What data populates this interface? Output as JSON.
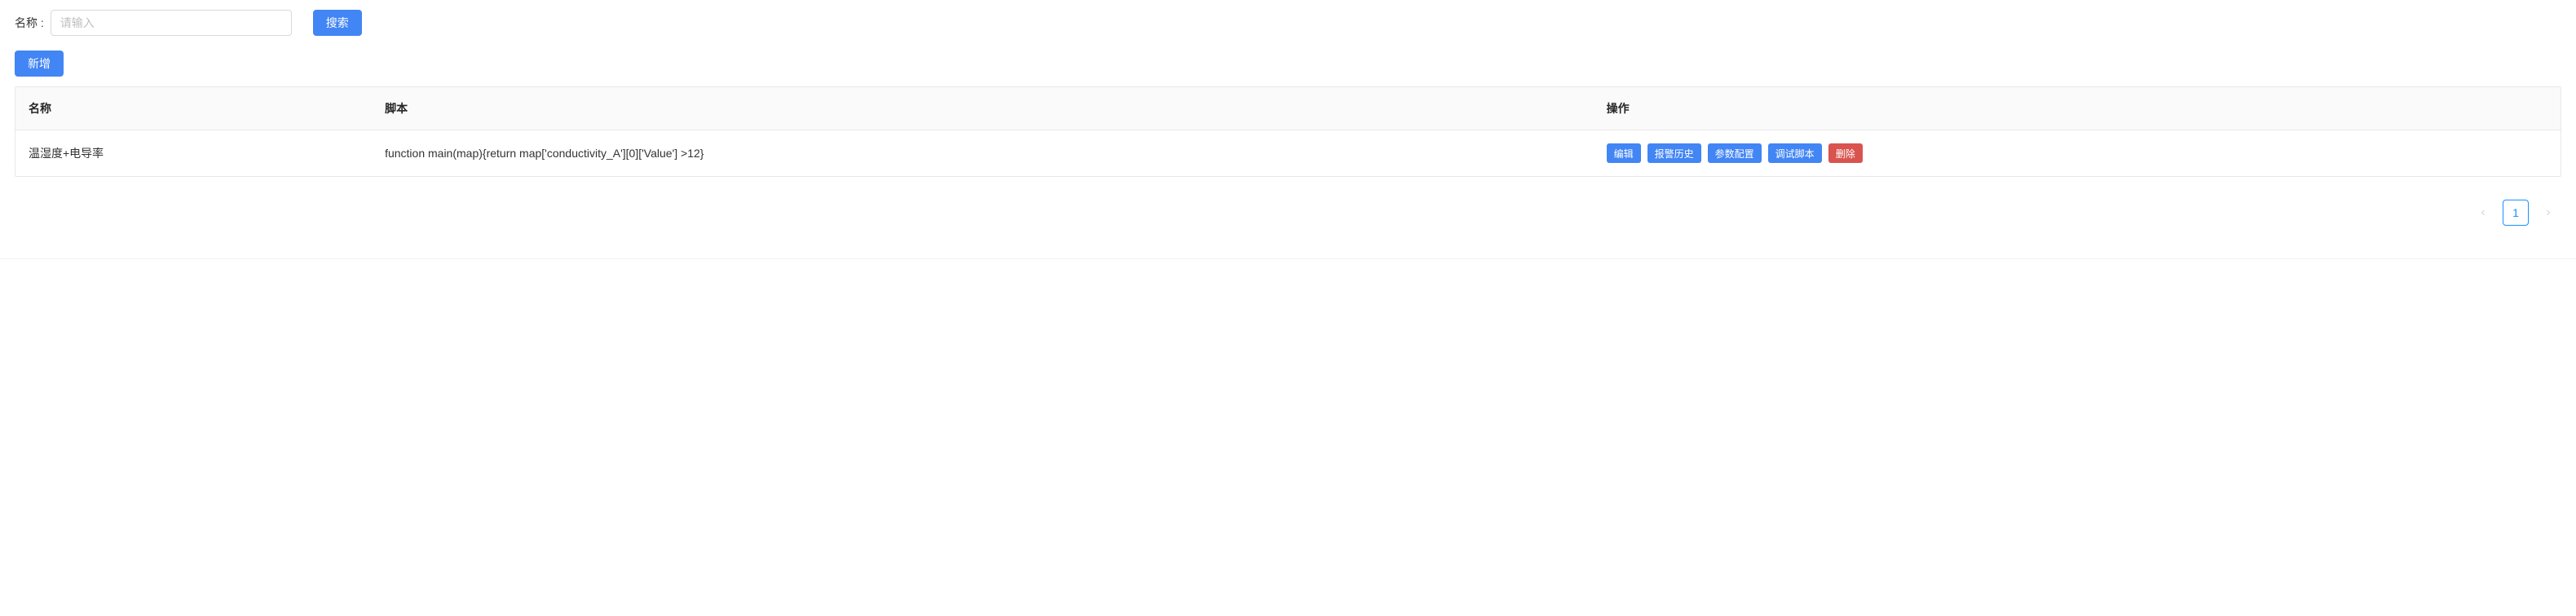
{
  "search": {
    "label": "名称 :",
    "placeholder": "请输入",
    "value": "",
    "button": "搜索"
  },
  "toolbar": {
    "add": "新增"
  },
  "table": {
    "headers": {
      "name": "名称",
      "script": "脚本",
      "actions": "操作"
    },
    "rows": [
      {
        "name": "温湿度+电导率",
        "script": "function main(map){return map['conductivity_A'][0]['Value'] >12}"
      }
    ]
  },
  "actions": {
    "edit": "编辑",
    "alarmHistory": "报警历史",
    "paramConfig": "参数配置",
    "debugScript": "调试脚本",
    "delete": "删除"
  },
  "pagination": {
    "current": "1"
  }
}
